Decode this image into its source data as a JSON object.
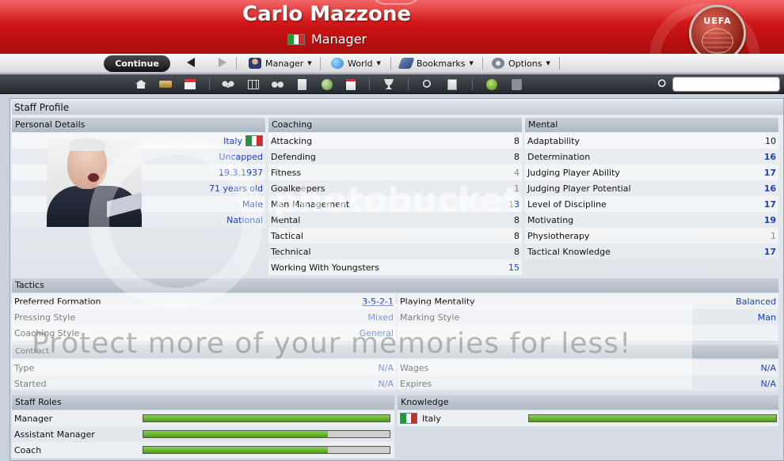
{
  "header": {
    "name": "Carlo Mazzone",
    "role": "Manager",
    "badge": "UEFA"
  },
  "menubar": {
    "continue_label": "Continue",
    "menus": [
      "Manager",
      "World",
      "Bookmarks",
      "Options"
    ]
  },
  "page_title": "Staff Profile",
  "personal": {
    "header": "Personal Details",
    "nationality": "Italy",
    "caps": "Uncapped",
    "dob": "19.3.1937",
    "age": "71 years old",
    "gender": "Male",
    "level": "National"
  },
  "coaching": {
    "header": "Coaching",
    "rows": [
      {
        "label": "Attacking",
        "value": "8",
        "style": ""
      },
      {
        "label": "Defending",
        "value": "8",
        "style": ""
      },
      {
        "label": "Fitness",
        "value": "4",
        "style": "grey"
      },
      {
        "label": "Goalkeepers",
        "value": "1",
        "style": "grey"
      },
      {
        "label": "Man Management",
        "value": "13",
        "style": "blue"
      },
      {
        "label": "Mental",
        "value": "8",
        "style": ""
      },
      {
        "label": "Tactical",
        "value": "8",
        "style": ""
      },
      {
        "label": "Technical",
        "value": "8",
        "style": ""
      },
      {
        "label": "Working With Youngsters",
        "value": "15",
        "style": "blue"
      }
    ]
  },
  "mental": {
    "header": "Mental",
    "rows": [
      {
        "label": "Adaptability",
        "value": "10",
        "style": ""
      },
      {
        "label": "Determination",
        "value": "16",
        "style": "blue bold"
      },
      {
        "label": "Judging Player Ability",
        "value": "17",
        "style": "blue bold"
      },
      {
        "label": "Judging Player Potential",
        "value": "16",
        "style": "blue bold"
      },
      {
        "label": "Level of Discipline",
        "value": "17",
        "style": "blue bold"
      },
      {
        "label": "Motivating",
        "value": "19",
        "style": "blue bold"
      },
      {
        "label": "Physiotherapy",
        "value": "1",
        "style": "grey"
      },
      {
        "label": "Tactical Knowledge",
        "value": "17",
        "style": "blue bold"
      }
    ]
  },
  "tactics": {
    "header": "Tactics",
    "preferred_formation_label": "Preferred Formation",
    "preferred_formation": "3-5-2-1",
    "playing_mentality_label": "Playing Mentality",
    "playing_mentality": "Balanced",
    "pressing_style_label": "Pressing Style",
    "pressing_style": "Mixed",
    "marking_style_label": "Marking Style",
    "marking_style": "Man",
    "coaching_style_label": "Coaching Style",
    "coaching_style": "General"
  },
  "contract": {
    "header": "Contract",
    "type_label": "Type",
    "type": "N/A",
    "wages_label": "Wages",
    "wages": "N/A",
    "started_label": "Started",
    "started": "N/A",
    "expires_label": "Expires",
    "expires": "N/A"
  },
  "staff_roles": {
    "header": "Staff Roles",
    "rows": [
      {
        "label": "Manager",
        "level": 1.0
      },
      {
        "label": "Assistant Manager",
        "level": 0.75
      },
      {
        "label": "Coach",
        "level": 0.75
      }
    ]
  },
  "knowledge": {
    "header": "Knowledge",
    "rows": [
      {
        "label": "Italy",
        "level": 1.0
      }
    ]
  },
  "watermark": {
    "banner": "Protect more of your memories for less!",
    "brand": "photobucket"
  },
  "colors": {
    "header_red": "#c81313",
    "value_blue": "#1b3fb8",
    "bar_green": "#5fae2a"
  },
  "icons": [
    "home-icon",
    "inbox-icon",
    "calendar-icon",
    "squad-icon",
    "tactics-icon",
    "training-icon",
    "notes-icon",
    "scouting-icon",
    "documents-icon",
    "trophy-icon",
    "search-staff-icon",
    "clipboard-icon",
    "help-icon",
    "info-icon",
    "search-icon"
  ]
}
